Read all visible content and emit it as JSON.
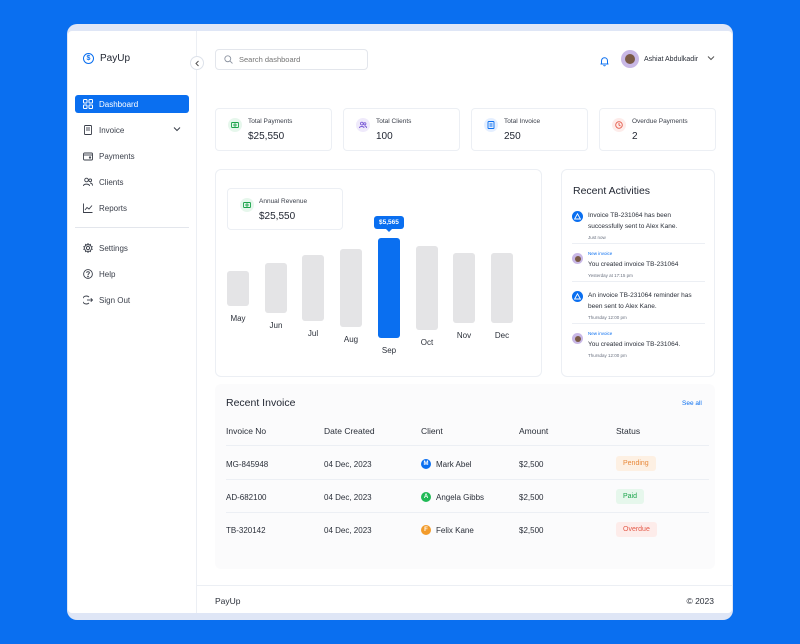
{
  "brand": {
    "logo_letter": "$",
    "name": "PayUp"
  },
  "sidebar": {
    "items": [
      {
        "label": "Dashboard",
        "icon": "grid-icon",
        "active": true
      },
      {
        "label": "Invoice",
        "icon": "document-icon",
        "has_submenu": true
      },
      {
        "label": "Payments",
        "icon": "wallet-icon"
      },
      {
        "label": "Clients",
        "icon": "users-icon"
      },
      {
        "label": "Reports",
        "icon": "chart-line-icon"
      }
    ],
    "secondary": [
      {
        "label": "Settings",
        "icon": "gear-icon"
      },
      {
        "label": "Help",
        "icon": "help-icon"
      },
      {
        "label": "Sign Out",
        "icon": "logout-icon"
      }
    ]
  },
  "header": {
    "search_placeholder": "Search dashboard",
    "user_name": "Ashiat Abdulkadir"
  },
  "stats": [
    {
      "label": "Total Payments",
      "value": "$25,550",
      "icon": "money-icon",
      "bg": "#e6f7ec",
      "fg": "#1aa34a"
    },
    {
      "label": "Total Clients",
      "value": "100",
      "icon": "users-icon",
      "bg": "#efeafb",
      "fg": "#7b5cd6"
    },
    {
      "label": "Total Invoice",
      "value": "250",
      "icon": "invoice-icon",
      "bg": "#e5efff",
      "fg": "#0a6ff0"
    },
    {
      "label": "Overdue Payments",
      "value": "2",
      "icon": "clock-icon",
      "bg": "#fdecea",
      "fg": "#e45b4a"
    }
  ],
  "revenue": {
    "label": "Annual Revenue",
    "value": "$25,550"
  },
  "chart_data": {
    "type": "bar",
    "categories": [
      "May",
      "Jun",
      "Jul",
      "Aug",
      "Sep",
      "Oct",
      "Nov",
      "Dec"
    ],
    "values": [
      35,
      50,
      66,
      78,
      100,
      84,
      70,
      70
    ],
    "highlight_index": 4,
    "highlight_label": "$5,565",
    "highlight_color": "#0a6ff0",
    "bar_color": "#e4e4e6"
  },
  "activities": {
    "title": "Recent Activities",
    "items": [
      {
        "type": "system",
        "tag": "",
        "text": "Invoice TB-231064 has been successfully sent to Alex Kane.",
        "time": "Just now"
      },
      {
        "type": "user",
        "tag": "New invoice",
        "text": "You created invoice TB-231064",
        "time": "Yesterday at 17:15 pm"
      },
      {
        "type": "system",
        "tag": "",
        "text": "An invoice TB-231064 reminder has been sent to Alex Kane.",
        "time": "Thursday 12:00 pm"
      },
      {
        "type": "user",
        "tag": "New invoice",
        "text": "You created invoice TB-231064.",
        "time": "Thursday 12:00 pm"
      }
    ]
  },
  "invoices": {
    "title": "Recent Invoice",
    "see_all": "See all",
    "columns": [
      "Invoice No",
      "Date Created",
      "Client",
      "Amount",
      "Status"
    ],
    "rows": [
      {
        "no": "MG-845948",
        "date": "04 Dec, 2023",
        "client": "Mark Abel",
        "initial": "M",
        "badge": "#0a6ff0",
        "amount": "$2,500",
        "status": "Pending",
        "status_bg": "#fdf0e3",
        "status_fg": "#e8893a"
      },
      {
        "no": "AD-682100",
        "date": "04 Dec, 2023",
        "client": "Angela Gibbs",
        "initial": "A",
        "badge": "#20b956",
        "amount": "$2,500",
        "status": "Paid",
        "status_bg": "#e6f7ec",
        "status_fg": "#1aa34a"
      },
      {
        "no": "TB-320142",
        "date": "04 Dec, 2023",
        "client": "Felix Kane",
        "initial": "F",
        "badge": "#f29b2b",
        "amount": "$2,500",
        "status": "Overdue",
        "status_bg": "#fdecea",
        "status_fg": "#e45b4a"
      }
    ]
  },
  "footer": {
    "left": "PayUp",
    "right": "© 2023"
  }
}
